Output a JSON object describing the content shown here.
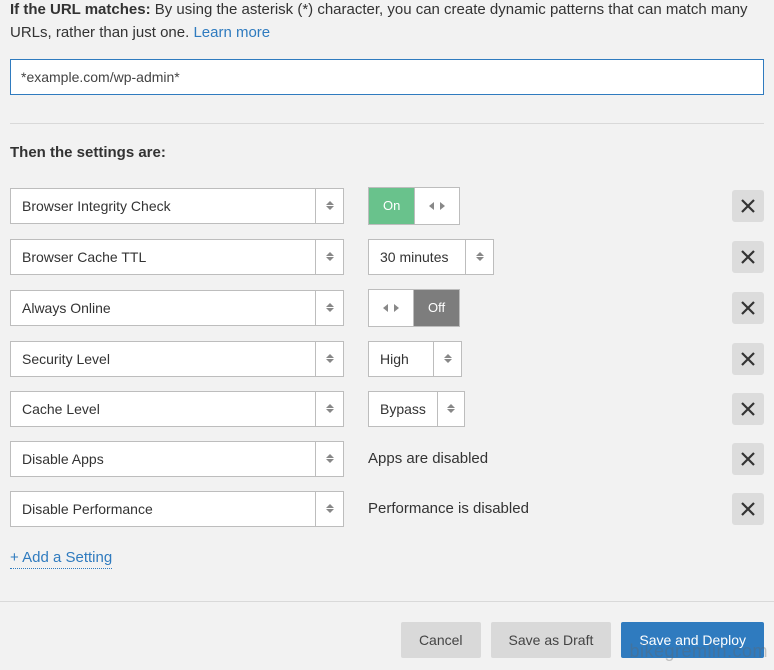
{
  "intro": {
    "label": "If the URL matches:",
    "text": " By using the asterisk (*) character, you can create dynamic patterns that can match many URLs, rather than just one. ",
    "learn": "Learn more"
  },
  "url_value": "*example.com/wp-admin*",
  "section_title": "Then the settings are:",
  "settings": [
    {
      "name": "Browser Integrity Check",
      "value_type": "toggle_on",
      "value_on": "On"
    },
    {
      "name": "Browser Cache TTL",
      "value_type": "select",
      "value": "30 minutes"
    },
    {
      "name": "Always Online",
      "value_type": "toggle_off",
      "value_off": "Off"
    },
    {
      "name": "Security Level",
      "value_type": "select_sm",
      "value": "High"
    },
    {
      "name": "Cache Level",
      "value_type": "select_sm2",
      "value": "Bypass"
    },
    {
      "name": "Disable Apps",
      "value_type": "text",
      "value": "Apps are disabled"
    },
    {
      "name": "Disable Performance",
      "value_type": "text",
      "value": "Performance is disabled"
    }
  ],
  "add_label": "+ Add a Setting",
  "buttons": {
    "cancel": "Cancel",
    "draft": "Save as Draft",
    "deploy": "Save and Deploy"
  },
  "watermark": "bikegremlin.com"
}
